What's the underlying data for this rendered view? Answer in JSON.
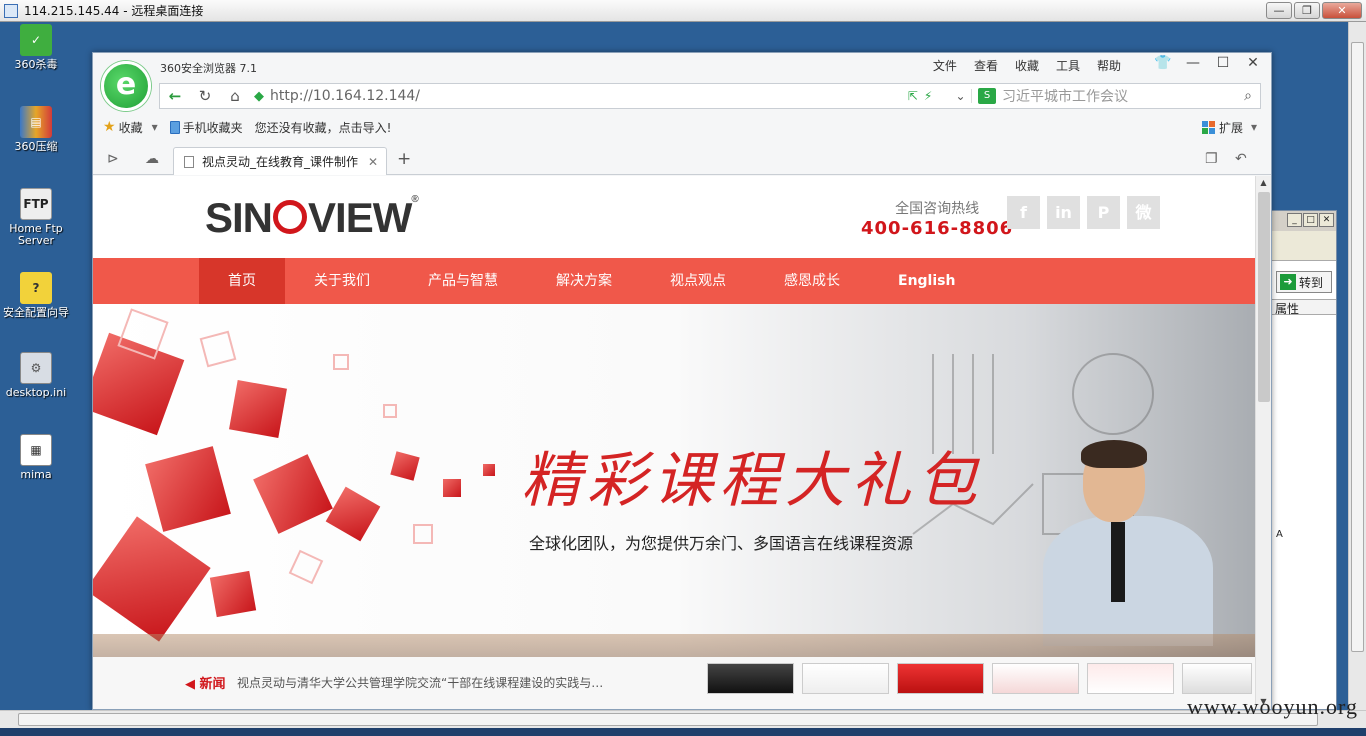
{
  "rdp": {
    "title": "114.215.145.44 - 远程桌面连接"
  },
  "desktop_icons": [
    {
      "label": "360杀毒",
      "icon": "shield-360-icon"
    },
    {
      "label": "360压缩",
      "icon": "archive-icon"
    },
    {
      "label": "Home Ftp Server",
      "icon": "ftp-icon"
    },
    {
      "label": "安全配置向导",
      "icon": "security-wizard-icon"
    },
    {
      "label": "desktop.ini",
      "icon": "settings-file-icon"
    },
    {
      "label": "mima",
      "icon": "text-file-icon"
    }
  ],
  "side_window": {
    "go_label": "转到",
    "prop_label": "属性",
    "letter": "A"
  },
  "browser": {
    "app_name": "360安全浏览器 7.1",
    "menu": [
      "文件",
      "查看",
      "收藏",
      "工具",
      "帮助"
    ],
    "url": "http://10.164.12.144/",
    "search_placeholder": "习近平城市工作会议",
    "favorites_label": "收藏",
    "mobile_fav_label": "手机收藏夹",
    "no_fav_text": "您还没有收藏，点击导入!",
    "extension_label": "扩展",
    "tab_title": "视点灵动_在线教育_课件制作"
  },
  "site": {
    "logo_pre": "SIN",
    "logo_post": "VIEW",
    "logo_reg": "®",
    "hotline_label": "全国咨询热线",
    "hotline_number": "400-616-8806",
    "social": [
      "f",
      "in",
      "P",
      "微"
    ],
    "nav": [
      "首页",
      "关于我们",
      "产品与智慧",
      "解决方案",
      "视点观点",
      "感恩成长",
      "English"
    ],
    "banner_title": "精彩课程大礼包",
    "banner_tagline": "全球化团队，为您提供万余门、多国语言在线课程资源",
    "news_label": "新闻",
    "news_text": "视点灵动与清华大学公共管理学院交流“干部在线课程建设的实践与…"
  },
  "watermark": "www.wooyun.org",
  "colors": {
    "brand_red": "#d1161b",
    "nav_red": "#f0584a",
    "nav_active": "#d7362a",
    "desktop_blue": "#2c5f96"
  }
}
